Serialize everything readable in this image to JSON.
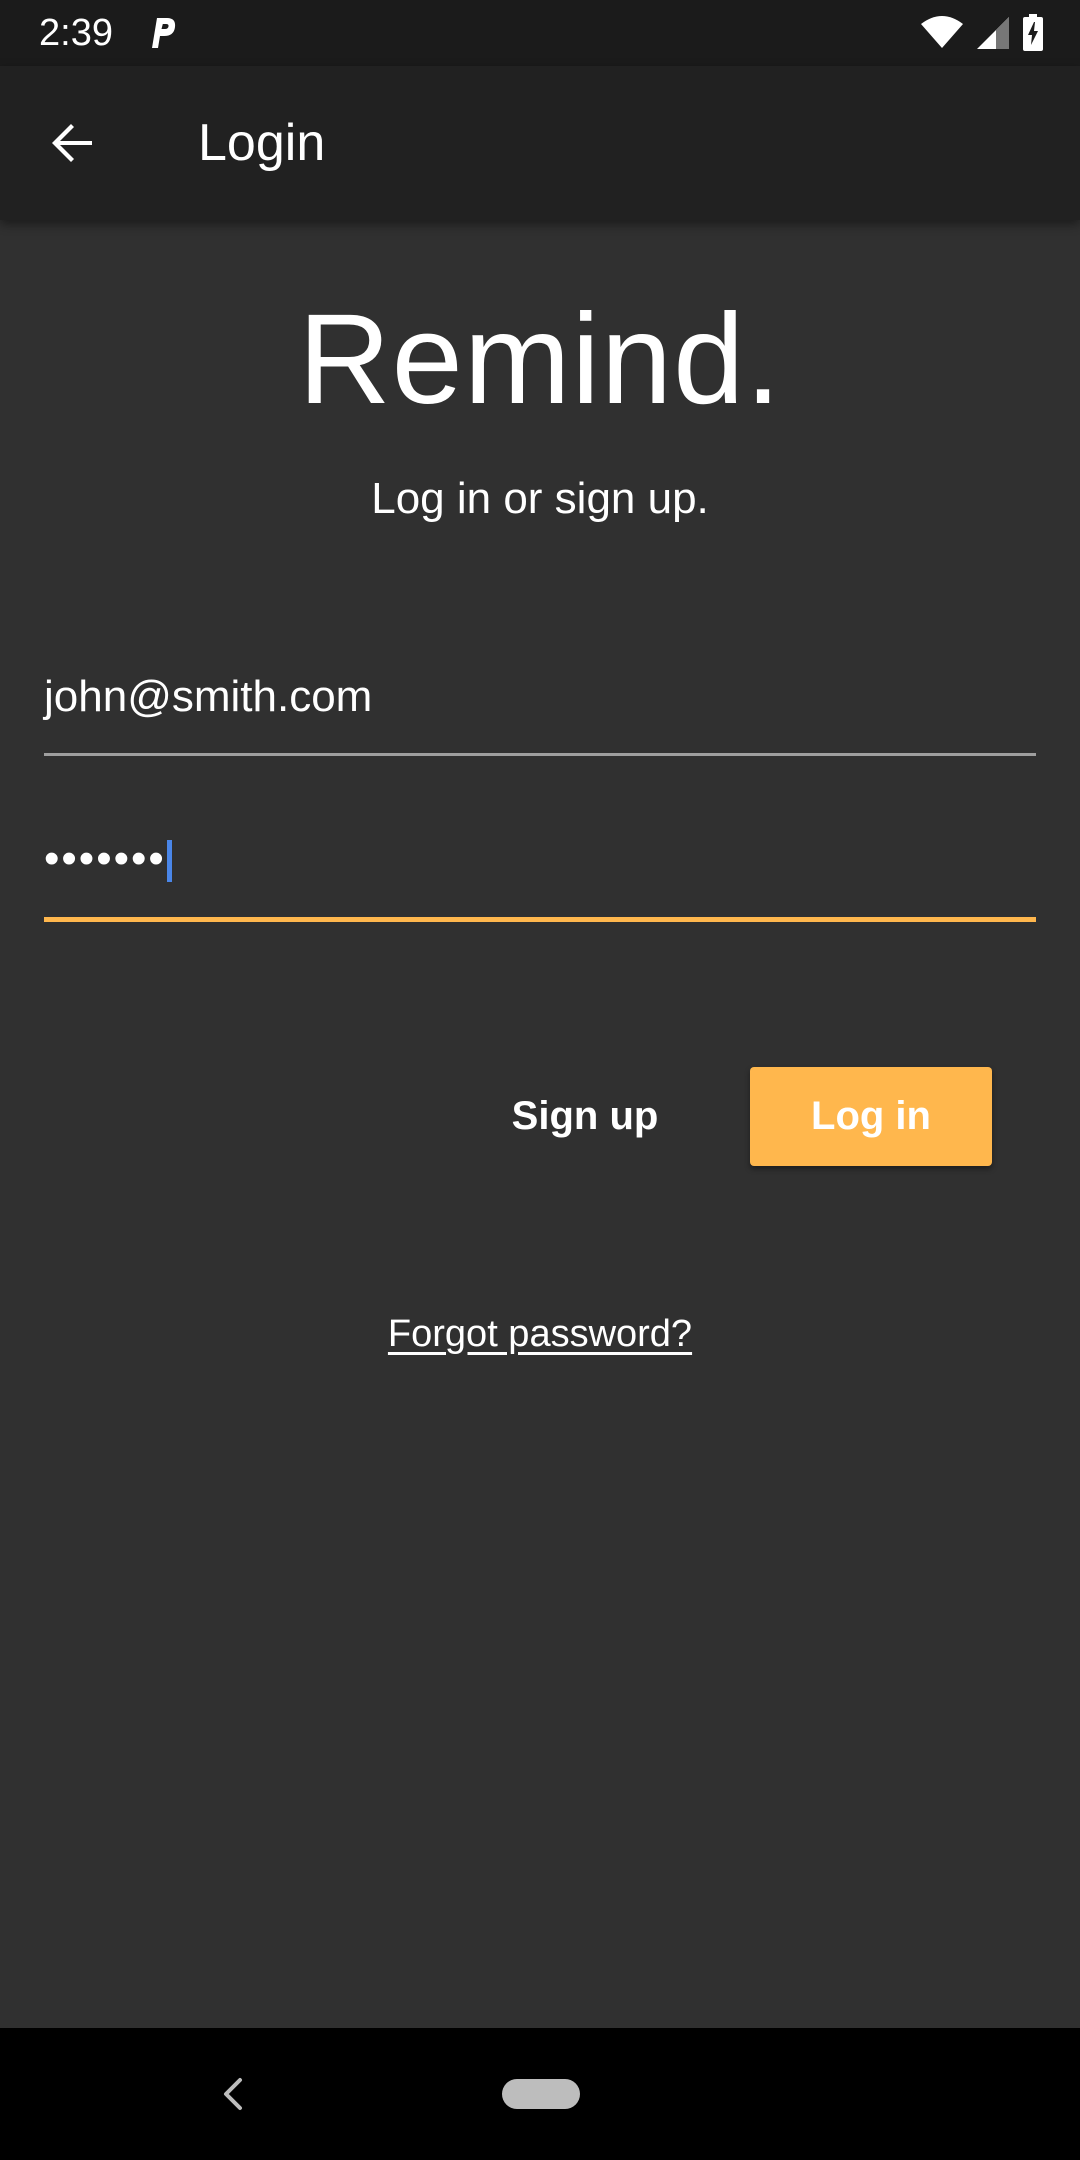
{
  "status_bar": {
    "time": "2:39",
    "icons": [
      "p-notification-icon",
      "wifi-icon",
      "cell-signal-icon",
      "battery-charging-icon"
    ]
  },
  "app_bar": {
    "title": "Login",
    "back_icon": "arrow-back-icon"
  },
  "brand": {
    "title": "Remind.",
    "subtitle": "Log in or sign up."
  },
  "form": {
    "email_value": "john@smith.com",
    "password_masked": "•••••••"
  },
  "actions": {
    "signup_label": "Sign up",
    "login_label": "Log in",
    "forgot_label": "Forgot password?"
  },
  "colors": {
    "background": "#303030",
    "app_bar": "#212121",
    "status_bar": "#1b1b1b",
    "accent": "#ffb74d",
    "cursor": "#4a86e8"
  }
}
